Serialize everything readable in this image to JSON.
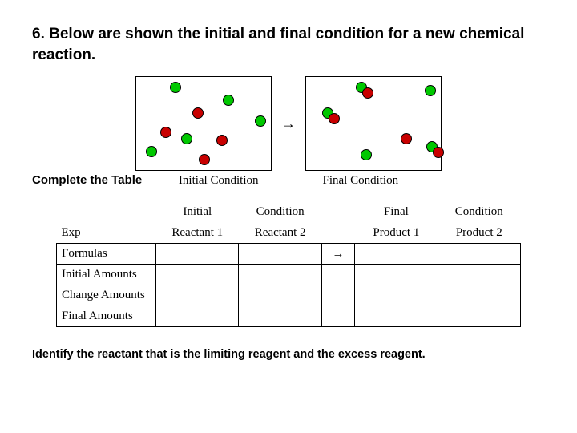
{
  "title": "6. Below are shown the initial and final condition for a new chemical reaction.",
  "arrow": "→",
  "labels": {
    "initial": "Initial Condition",
    "final": "Final Condition"
  },
  "instruction": "Complete the Table",
  "header1": [
    "",
    "Initial",
    "Condition",
    "",
    "Final",
    "Condition"
  ],
  "header2": [
    "Exp",
    "Reactant 1",
    "Reactant 2",
    "",
    "Product 1",
    "Product 2"
  ],
  "rows": {
    "formulas": [
      "Formulas",
      "",
      "",
      "→",
      "",
      ""
    ],
    "initial": [
      "Initial Amounts",
      "",
      "",
      "",
      "",
      ""
    ],
    "change": [
      "Change Amounts",
      "",
      "",
      "",
      "",
      ""
    ],
    "final": [
      "Final Amounts",
      "",
      "",
      "",
      "",
      ""
    ]
  },
  "bottom": "Identify the reactant that is the limiting reagent and the excess reagent."
}
